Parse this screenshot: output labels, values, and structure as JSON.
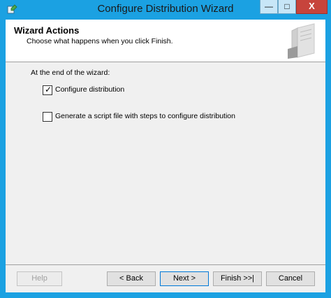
{
  "window": {
    "title": "Configure Distribution Wizard",
    "icon": "wizard-icon"
  },
  "titlebar": {
    "minimize_glyph": "—",
    "maximize_glyph": "□",
    "close_glyph": "X"
  },
  "header": {
    "title": "Wizard Actions",
    "subtitle": "Choose what happens when you click Finish."
  },
  "body": {
    "prompt": "At the end of the wizard:",
    "options": [
      {
        "label": "Configure distribution",
        "checked": true
      },
      {
        "label": "Generate a script file with steps to configure distribution",
        "checked": false
      }
    ]
  },
  "buttons": {
    "help": "Help",
    "back": "< Back",
    "next": "Next >",
    "finish": "Finish >>|",
    "cancel": "Cancel"
  }
}
